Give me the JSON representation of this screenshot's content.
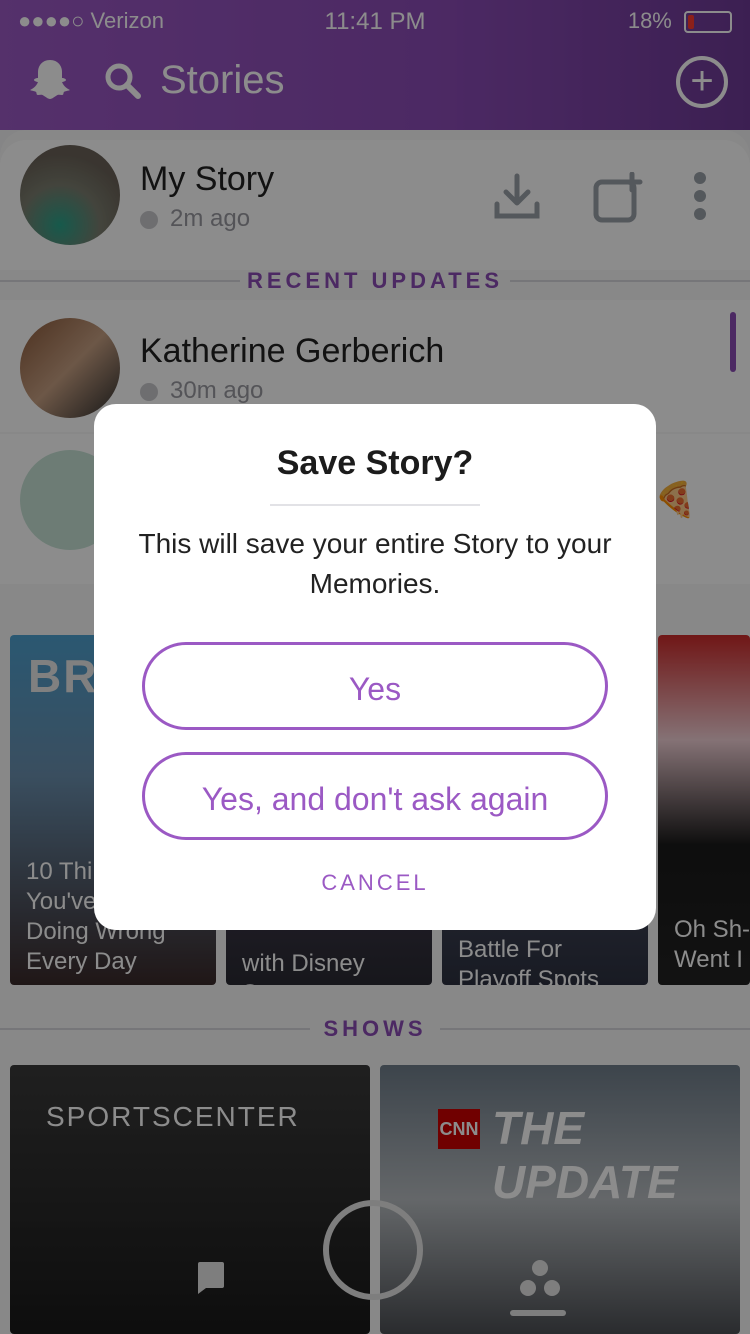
{
  "status": {
    "carrier": "●●●●○ Verizon",
    "time": "11:41 PM",
    "battery": "18%"
  },
  "header": {
    "title": "Stories"
  },
  "my_story": {
    "name": "My Story",
    "time": "2m ago"
  },
  "sections": {
    "recent": "RECENT UPDATES",
    "shows": "SHOWS"
  },
  "recent": [
    {
      "name": "Katherine Gerberich",
      "time": "30m ago"
    }
  ],
  "discover_tiles": [
    {
      "caption": "10 Things You've Been Doing Wrong Every Day",
      "visible_caption": "10 Thi\nYou've\nDoing Wrong\nEvery Day",
      "brand": "BRO"
    },
    {
      "caption": "with Disney Stars"
    },
    {
      "caption": "Battle For Playoff Spots"
    },
    {
      "caption": "Oh Sh- Went I"
    }
  ],
  "shows": [
    {
      "name": "SPORTSCENTER"
    },
    {
      "name": "THE UPDATE",
      "brand": "CNN"
    }
  ],
  "dialog": {
    "title": "Save Story?",
    "message": "This will save your entire Story to your Memories.",
    "yes": "Yes",
    "yes_dont_ask": "Yes, and don't ask again",
    "cancel": "CANCEL"
  },
  "colors": {
    "accent": "#9b59c4"
  }
}
